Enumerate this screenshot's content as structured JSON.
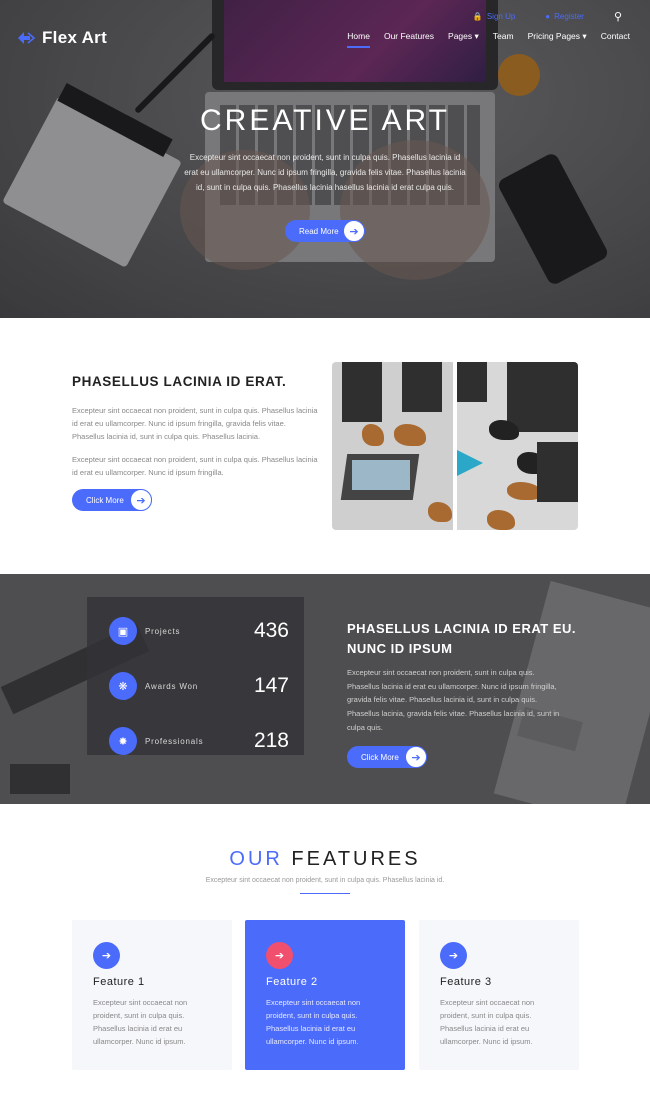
{
  "brand": {
    "name": "Flex Art",
    "accent": "#4b6bfb",
    "accent_alt": "#f0506e"
  },
  "topbar": {
    "item1": "Sign Up",
    "item2": "Register"
  },
  "nav": {
    "items": [
      "Home",
      "Our Features",
      "Pages",
      "Team",
      "Pricing Pages",
      "Contact"
    ]
  },
  "hero": {
    "title": "CREATIVE ART",
    "text": "Excepteur sint occaecat non proident, sunt in culpa quis. Phasellus lacinia id erat eu ullamcorper. Nunc id ipsum fringilla, gravida felis vitae. Phasellus lacinia id, sunt in culpa quis. Phasellus lacinia hasellus lacinia id erat culpa quis.",
    "button": "Read More"
  },
  "about": {
    "title": "PHASELLUS LACINIA ID ERAT.",
    "para1": "Excepteur sint occaecat non proident, sunt in culpa quis. Phasellus lacinia id erat eu ullamcorper. Nunc id ipsum fringilla, gravida felis vitae. Phasellus lacinia id, sunt in culpa quis. Phasellus lacinia.",
    "para2": "Excepteur sint occaecat non proident, sunt in culpa quis. Phasellus lacinia id erat eu ullamcorper. Nunc id ipsum fringilla.",
    "button": "Click More"
  },
  "stats": {
    "items": [
      {
        "label": "Projects",
        "value": "436",
        "icon": "folder-icon"
      },
      {
        "label": "Awards Won",
        "value": "147",
        "icon": "award-icon"
      },
      {
        "label": "Professionals",
        "value": "218",
        "icon": "bug-icon"
      }
    ],
    "title": "PHASELLUS LACINIA ID ERAT EU. NUNC ID IPSUM",
    "text": "Excepteur sint occaecat non proident, sunt in culpa quis. Phasellus lacinia id erat eu ullamcorper. Nunc id ipsum fringilla, gravida felis vitae. Phasellus lacinia id, sunt in culpa quis. Phasellus lacinia, gravida felis vitae. Phasellus lacinia id, sunt in culpa quis.",
    "button": "Click More"
  },
  "features": {
    "title_accent": "OUR",
    "title_rest": "FEATURES",
    "subtitle": "Excepteur sint occaecat non proident, sunt in culpa quis. Phasellus lacinia id.",
    "cards": [
      {
        "title": "Feature 1",
        "text": "Excepteur sint occaecat non proident, sunt in culpa quis. Phasellus lacinia id erat eu ullamcorper. Nunc id ipsum."
      },
      {
        "title": "Feature 2",
        "text": "Excepteur sint occaecat non proident, sunt in culpa quis. Phasellus lacinia id erat eu ullamcorper. Nunc id ipsum."
      },
      {
        "title": "Feature 3",
        "text": "Excepteur sint occaecat non proident, sunt in culpa quis. Phasellus lacinia id erat eu ullamcorper. Nunc id ipsum."
      }
    ]
  }
}
